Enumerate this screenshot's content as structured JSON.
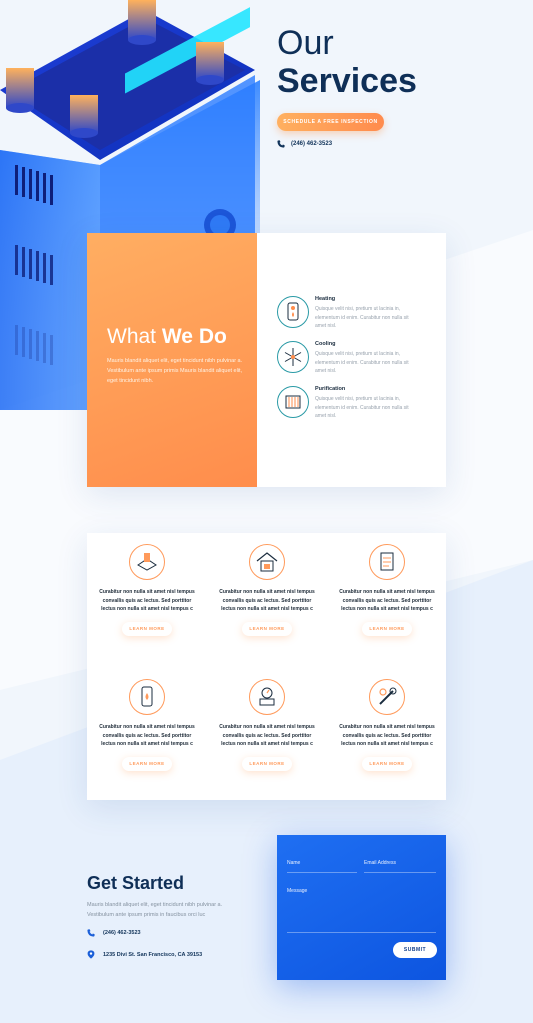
{
  "colors": {
    "navy": "#0f2f57",
    "orange": "#ff8d4c",
    "blue": "#1f6ff2",
    "teal": "#2a9aa6"
  },
  "hero": {
    "title_line1": "Our",
    "title_line2": "Services",
    "button_label": "SCHEDULE A FREE INSPECTION",
    "phone": "(246) 462-3523"
  },
  "what_we_do": {
    "title_light": "What ",
    "title_bold": "We Do",
    "description": "Mauris blandit aliquet elit, eget tincidunt nibh pulvinar a. Vestibulum ante ipsum primis Mauris blandit aliquet elit, eget tincidunt nibh.",
    "services": [
      {
        "name": "Heating",
        "icon": "water-heater-icon",
        "description": "Quisque velit nisi, pretium ut lacinia in, elementum id enim. Curabitur non nulla sit amet nisl."
      },
      {
        "name": "Cooling",
        "icon": "snowflake-icon",
        "description": "Quisque velit nisi, pretium ut lacinia in, elementum id enim. Curabitur non nulla sit amet nisl."
      },
      {
        "name": "Purification",
        "icon": "air-filter-icon",
        "description": "Quisque velit nisi, pretium ut lacinia in, elementum id enim. Curabitur non nulla sit amet nisl."
      }
    ]
  },
  "features": {
    "items": [
      {
        "icon": "air-vent-icon",
        "text": "Curabitur non nulla sit amet nisl tempus convallis quis ac lectus. Sed porttitor lectus non nulla sit amet nisl tempus c",
        "button": "LEARN MORE"
      },
      {
        "icon": "house-furnace-icon",
        "text": "Curabitur non nulla sit amet nisl tempus convallis quis ac lectus. Sed porttitor lectus non nulla sit amet nisl tempus c",
        "button": "LEARN MORE"
      },
      {
        "icon": "clipboard-checklist-icon",
        "text": "Curabitur non nulla sit amet nisl tempus convallis quis ac lectus. Sed porttitor lectus non nulla sit amet nisl tempus c",
        "button": "LEARN MORE"
      },
      {
        "icon": "boiler-icon",
        "text": "Curabitur non nulla sit amet nisl tempus convallis quis ac lectus. Sed porttitor lectus non nulla sit amet nisl tempus c",
        "button": "LEARN MORE"
      },
      {
        "icon": "thermostat-gauge-icon",
        "text": "Curabitur non nulla sit amet nisl tempus convallis quis ac lectus. Sed porttitor lectus non nulla sit amet nisl tempus c",
        "button": "LEARN MORE"
      },
      {
        "icon": "wrench-gear-icon",
        "text": "Curabitur non nulla sit amet nisl tempus convallis quis ac lectus. Sed porttitor lectus non nulla sit amet nisl tempus c",
        "button": "LEARN MORE"
      }
    ]
  },
  "get_started": {
    "title": "Get Started",
    "description": "Mauris blandit aliquet elit, eget tincidunt nibh pulvinar a. Vestibulum ante ipsum primis in faucibus orci luc",
    "phone": "(246) 462-3523",
    "address": "1235 Divi St. San Francisco, CA 39153"
  },
  "form": {
    "name_label": "Name",
    "email_label": "Email Address",
    "message_label": "Message",
    "submit_label": "SUBMIT"
  }
}
